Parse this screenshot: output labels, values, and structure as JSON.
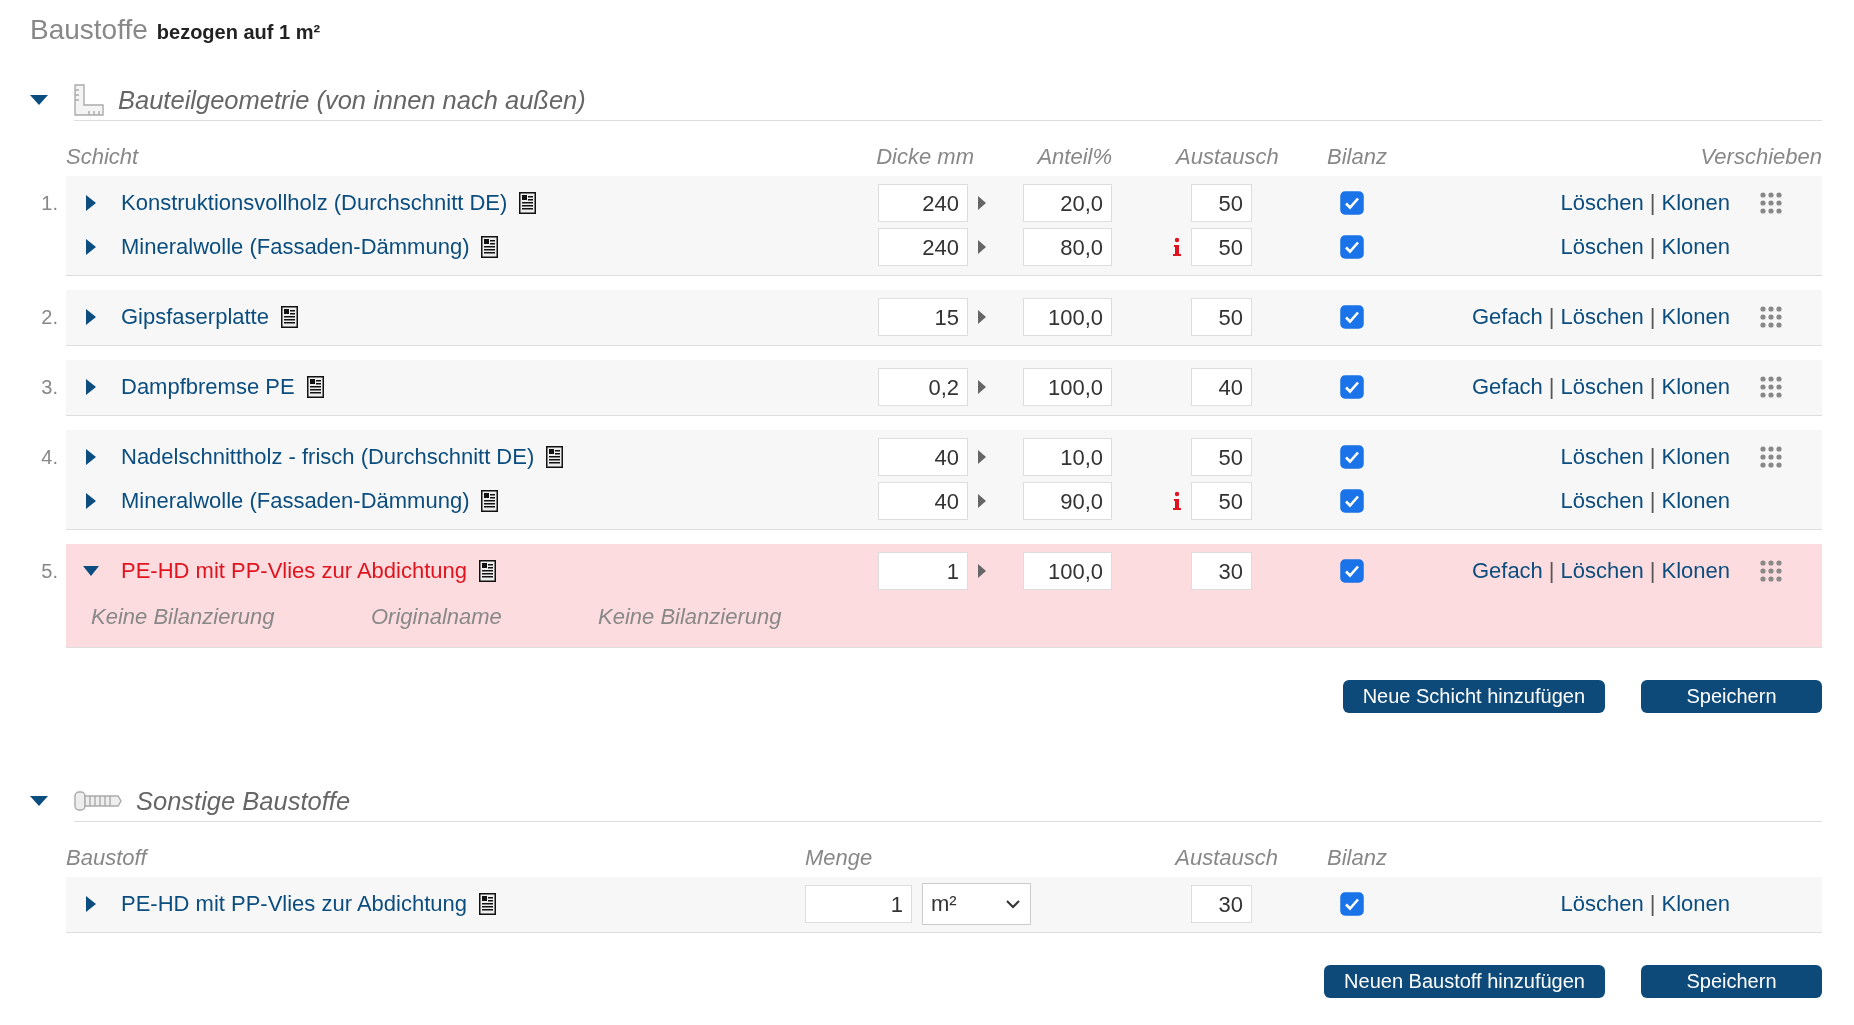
{
  "title": "Baustoffe",
  "title_note": "bezogen auf 1 m²",
  "separator": "|",
  "geometry": {
    "title": "Bauteilgeometrie (von innen nach außen)",
    "expanded": true,
    "columns": [
      "Schicht",
      "Dicke mm",
      "Anteil%",
      "Austausch",
      "Bilanz",
      "Verschieben"
    ],
    "layers": [
      {
        "number": "1.",
        "invalid": false,
        "materials": [
          {
            "name": "Konstruktionsvollholz (Durchschnitt DE)",
            "expanded": false,
            "thickness": "240",
            "share": "20,0",
            "info": false,
            "exchange": "50",
            "balance": true,
            "actions": [
              "Löschen",
              "Klonen"
            ],
            "draggable": true
          },
          {
            "name": "Mineralwolle (Fassaden-Dämmung)",
            "expanded": false,
            "thickness": "240",
            "share": "80,0",
            "info": true,
            "exchange": "50",
            "balance": true,
            "actions": [
              "Löschen",
              "Klonen"
            ],
            "draggable": false
          }
        ]
      },
      {
        "number": "2.",
        "invalid": false,
        "materials": [
          {
            "name": "Gipsfaserplatte",
            "expanded": false,
            "thickness": "15",
            "share": "100,0",
            "info": false,
            "exchange": "50",
            "balance": true,
            "actions": [
              "Gefach",
              "Löschen",
              "Klonen"
            ],
            "draggable": true
          }
        ]
      },
      {
        "number": "3.",
        "invalid": false,
        "materials": [
          {
            "name": "Dampfbremse PE",
            "expanded": false,
            "thickness": "0,2",
            "share": "100,0",
            "info": false,
            "exchange": "40",
            "balance": true,
            "actions": [
              "Gefach",
              "Löschen",
              "Klonen"
            ],
            "draggable": true
          }
        ]
      },
      {
        "number": "4.",
        "invalid": false,
        "materials": [
          {
            "name": "Nadelschnittholz - frisch (Durchschnitt DE)",
            "expanded": false,
            "thickness": "40",
            "share": "10,0",
            "info": false,
            "exchange": "50",
            "balance": true,
            "actions": [
              "Löschen",
              "Klonen"
            ],
            "draggable": true
          },
          {
            "name": "Mineralwolle (Fassaden-Dämmung)",
            "expanded": false,
            "thickness": "40",
            "share": "90,0",
            "info": true,
            "exchange": "50",
            "balance": true,
            "actions": [
              "Löschen",
              "Klonen"
            ],
            "draggable": false
          }
        ]
      },
      {
        "number": "5.",
        "invalid": true,
        "materials": [
          {
            "name": "PE-HD mit PP-Vlies zur Abdichtung",
            "expanded": true,
            "thickness": "1",
            "share": "100,0",
            "info": false,
            "exchange": "30",
            "balance": true,
            "actions": [
              "Gefach",
              "Löschen",
              "Klonen"
            ],
            "draggable": true,
            "details": [
              "Keine Bilanzierung",
              "Originalname",
              "Keine Bilanzierung"
            ]
          }
        ]
      }
    ],
    "buttons": [
      "Neue Schicht hinzufügen",
      "Speichern"
    ]
  },
  "other": {
    "title": "Sonstige Baustoffe",
    "expanded": true,
    "columns": [
      "Baustoff",
      "Menge",
      "Austausch",
      "Bilanz"
    ],
    "items": [
      {
        "name": "PE-HD mit PP-Vlies zur Abdichtung",
        "expanded": false,
        "quantity": "1",
        "unit": "m²",
        "exchange": "30",
        "balance": true,
        "actions": [
          "Löschen",
          "Klonen"
        ]
      }
    ],
    "buttons": [
      "Neuen Baustoff hinzufügen",
      "Speichern"
    ]
  }
}
